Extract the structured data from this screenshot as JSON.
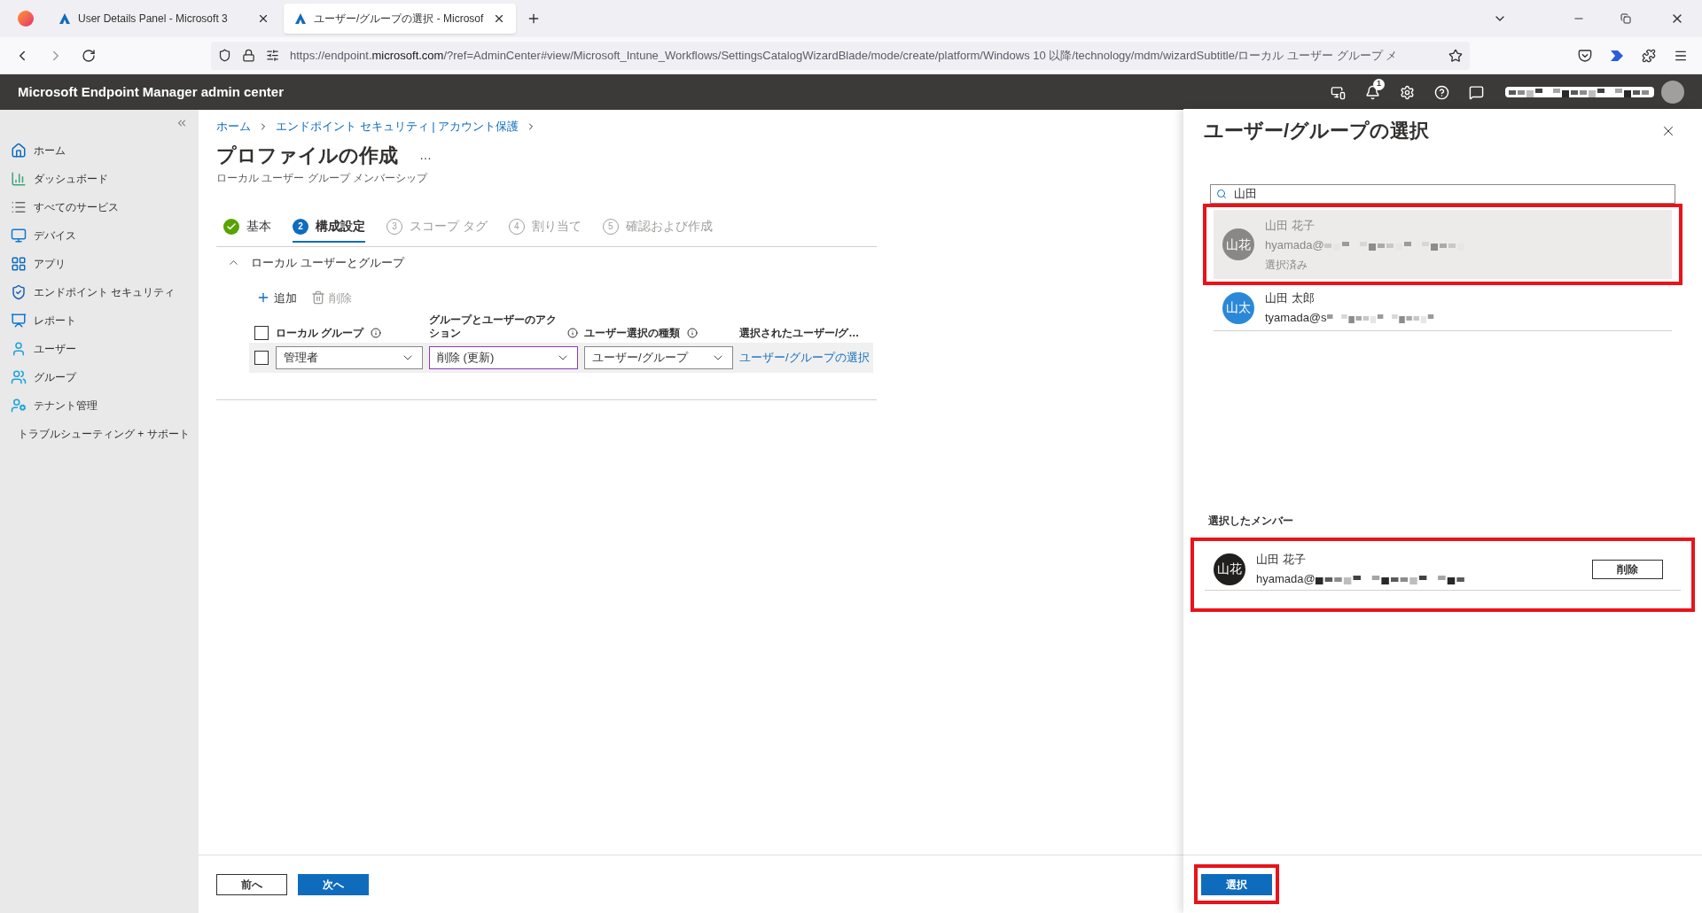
{
  "browser": {
    "tabs": [
      {
        "title": "User Details Panel - Microsoft 3",
        "selected": false
      },
      {
        "title": "ユーザー/グループの選択 - Microsof",
        "selected": true
      }
    ],
    "url": {
      "scheme": "https://endpoint.",
      "domain": "microsoft.com",
      "rest": "/?ref=AdminCenter#view/Microsoft_Intune_Workflows/SettingsCatalogWizardBlade/mode/create/platform/Windows 10 以降/technology/mdm/wizardSubtitle/ローカル ユーザー グループ メ"
    }
  },
  "header": {
    "title": "Microsoft Endpoint Manager admin center",
    "notification_count": "1"
  },
  "sidebar": {
    "items": [
      {
        "label": "ホーム"
      },
      {
        "label": "ダッシュボード"
      },
      {
        "label": "すべてのサービス"
      },
      {
        "label": "デバイス"
      },
      {
        "label": "アプリ"
      },
      {
        "label": "エンドポイント セキュリティ"
      },
      {
        "label": "レポート"
      },
      {
        "label": "ユーザー"
      },
      {
        "label": "グループ"
      },
      {
        "label": "テナント管理"
      },
      {
        "label": "トラブルシューティング + サポート"
      }
    ]
  },
  "breadcrumb": [
    "ホーム",
    "エンドポイント セキュリティ | アカウント保護"
  ],
  "page": {
    "title": "プロファイルの作成",
    "more": "…",
    "subtitle": "ローカル ユーザー グループ メンバーシップ"
  },
  "steps": [
    {
      "label": "基本",
      "kind": "complete"
    },
    {
      "label": "構成設定",
      "number": "2",
      "kind": "current"
    },
    {
      "label": "スコープ タグ",
      "number": "3",
      "kind": "pending"
    },
    {
      "label": "割り当て",
      "number": "4",
      "kind": "pending"
    },
    {
      "label": "確認および作成",
      "number": "5",
      "kind": "pending"
    }
  ],
  "section": {
    "title": "ローカル ユーザーとグループ",
    "expanded": true
  },
  "toolbar": [
    {
      "label": "追加",
      "disabled": false
    },
    {
      "label": "削除",
      "disabled": true
    }
  ],
  "table": {
    "select_all_checked": false,
    "columns": [
      {
        "label": "ローカル グループ",
        "info": true
      },
      {
        "label": "グループとユーザーのアクション",
        "info": true
      },
      {
        "label": "ユーザー選択の種類",
        "info": true
      },
      {
        "label": "選択されたユーザー/グ…",
        "info": false
      }
    ],
    "rows": [
      {
        "checked": false,
        "local_group": "管理者",
        "action": "削除 (更新)",
        "action_focused": true,
        "selection_type": "ユーザー/グループ",
        "link": "ユーザー/グループの選択"
      }
    ]
  },
  "footer": {
    "buttons": [
      {
        "label": "前へ",
        "primary": false
      },
      {
        "label": "次へ",
        "primary": true
      }
    ]
  },
  "panel": {
    "title": "ユーザー/グループの選択",
    "search": {
      "value": "山田"
    },
    "results": [
      {
        "initials": "山花",
        "name": "山田 花子",
        "email": "hyamada@",
        "status": "選択済み",
        "color": "#8a8886",
        "selected": true,
        "annotated": true
      },
      {
        "initials": "山太",
        "name": "山田 太郎",
        "email": "tyamada@s",
        "color": "#2b88d8",
        "selected": false,
        "annotated": false
      }
    ],
    "members_heading": "選択したメンバー",
    "members": [
      {
        "initials": "山花",
        "name": "山田 花子",
        "email": "hyamada@",
        "remove": "削除",
        "color": "#201f1e",
        "annotated": true
      }
    ],
    "select_button": {
      "label": "選択",
      "annotated": true
    }
  }
}
